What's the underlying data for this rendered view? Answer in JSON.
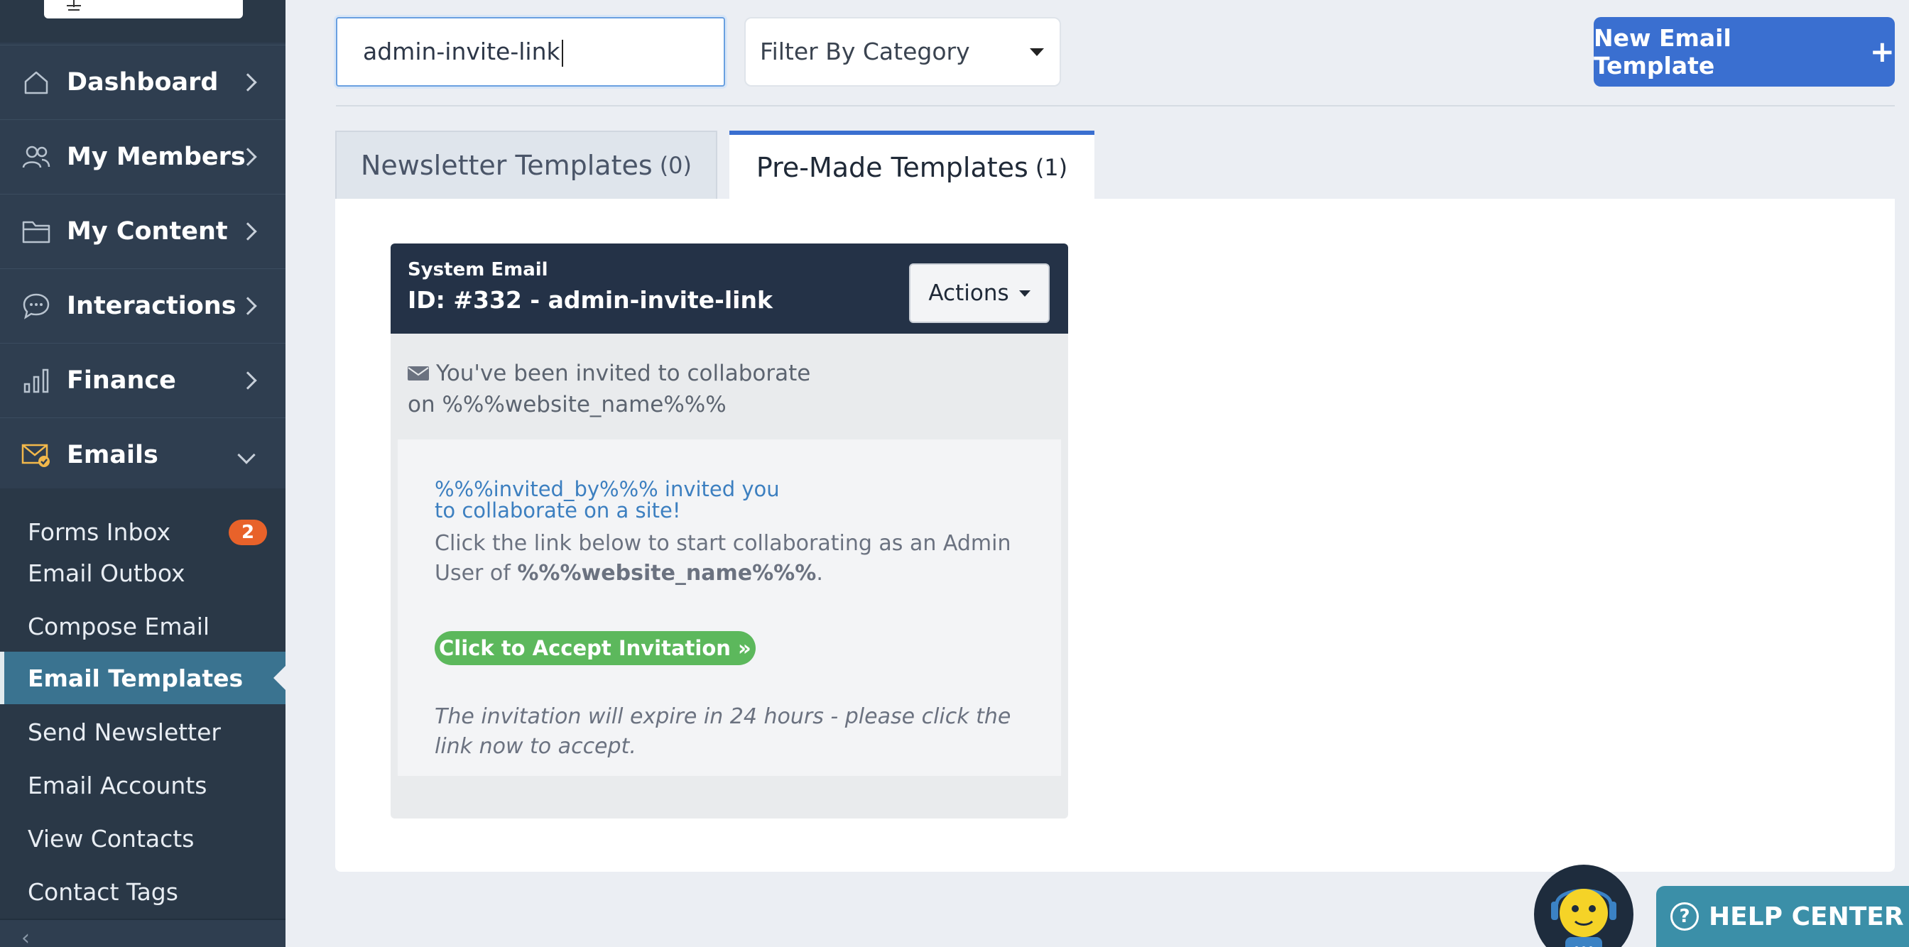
{
  "sidebar": {
    "nav": [
      {
        "label": "Dashboard",
        "icon": "home-icon"
      },
      {
        "label": "My Members",
        "icon": "members-icon"
      },
      {
        "label": "My Content",
        "icon": "folder-icon"
      },
      {
        "label": "Interactions",
        "icon": "chat-icon"
      },
      {
        "label": "Finance",
        "icon": "bar-chart-icon"
      },
      {
        "label": "Emails",
        "icon": "envelope-check-icon"
      }
    ],
    "email_submenu": [
      {
        "label": "Forms Inbox",
        "badge": "2"
      },
      {
        "label": "Email Outbox"
      },
      {
        "label": "Compose Email"
      },
      {
        "label": "Email Templates",
        "active": true
      },
      {
        "label": "Send Newsletter"
      },
      {
        "label": "Email Accounts"
      },
      {
        "label": "View Contacts"
      },
      {
        "label": "Contact Tags"
      }
    ]
  },
  "toolbar": {
    "search_value": "admin-invite-link",
    "filter_label": "Filter By Category",
    "new_button_label": "New Email Template"
  },
  "tabs": [
    {
      "label": "Newsletter Templates",
      "count": "(0)",
      "active": false
    },
    {
      "label": "Pre-Made Templates",
      "count": "(1)",
      "active": true
    }
  ],
  "template_card": {
    "type": "System Email",
    "title": "ID: #332 - admin-invite-link",
    "actions_label": "Actions",
    "subject": "You've been invited to collaborate on %%%website_name%%%",
    "body": {
      "invited_line": "%%%invited_by%%% invited you to collaborate on a site!",
      "click_prefix": "Click the link below to start collaborating as an Admin User of ",
      "click_bold": "%%%website_name%%%",
      "click_suffix": ".",
      "accept_button": "Click to Accept Invitation »",
      "expire_note": "The invitation will expire in 24 hours - please click the link now to accept."
    }
  },
  "help": {
    "label": "HELP CENTER"
  },
  "colors": {
    "sidebar_bg": "#2f3e50",
    "active_item": "#3a7390",
    "primary": "#3a6fd0",
    "badge": "#e8622a",
    "card_header": "#243247",
    "accept_green": "#5cb85c",
    "help_teal": "#3b8fa8"
  }
}
